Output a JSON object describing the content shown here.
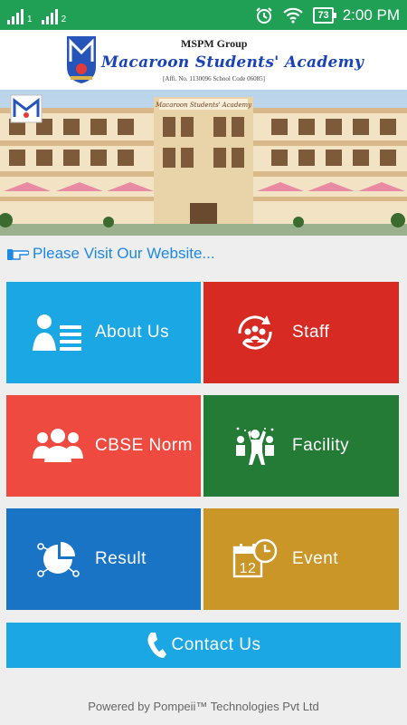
{
  "status_bar": {
    "sim1_label": "1",
    "sim2_label": "2",
    "battery": "73",
    "time": "2:00 PM"
  },
  "header": {
    "group": "MSPM Group",
    "academy": "Macaroon Students' Academy",
    "affiliation": "[Affi. No. 1130096 School Code 06085]"
  },
  "banner": {
    "building_sign": "Macaroon Students' Academy"
  },
  "visit_link": "Please Visit Our Website...",
  "tiles": {
    "about": "About Us",
    "staff": "Staff",
    "cbse": "CBSE Norm",
    "facility": "Facility",
    "result": "Result",
    "event": "Event"
  },
  "contact": "Contact Us",
  "footer": "Powered by Pompeii™ Technologies Pvt Ltd",
  "colors": {
    "status_bar": "#1fa055",
    "about": "#1ba7e3",
    "staff": "#d72a23",
    "cbse": "#ef4a3f",
    "facility": "#237b35",
    "result": "#1a74c6",
    "event": "#c99627",
    "contact": "#1ba7e3",
    "link": "#1e88e5"
  }
}
